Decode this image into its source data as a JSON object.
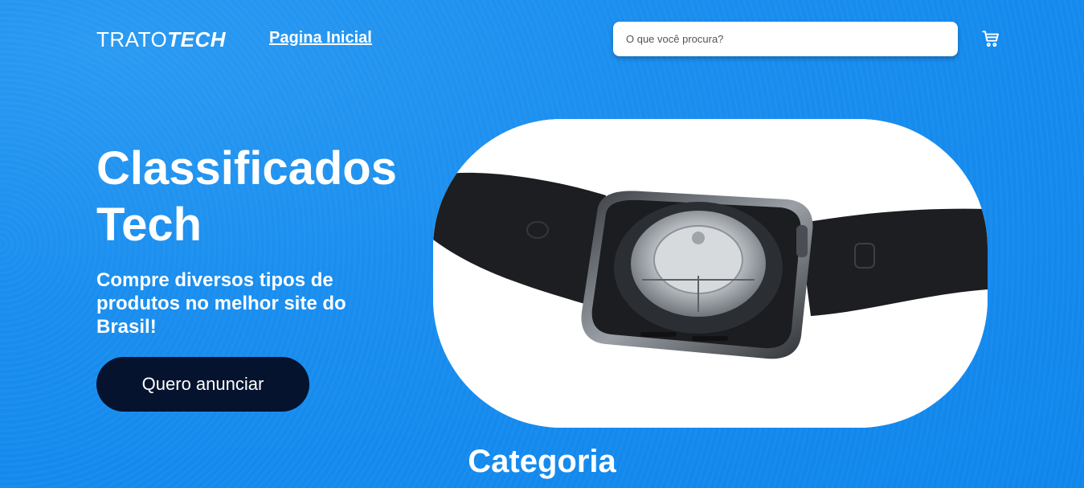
{
  "header": {
    "logo_part1": "TRATO",
    "logo_part2": "TECH",
    "nav_home": "Pagina Inicial",
    "search_placeholder": "O que você procura?",
    "cart_icon": "shopping-cart-icon"
  },
  "hero": {
    "title": "Classificados Tech",
    "subtitle": "Compre diversos tipos de produtos no melhor site do Brasil!",
    "cta_label": "Quero anunciar",
    "image_subject": "smartwatch-back-photo"
  },
  "sections": {
    "category_title": "Categoria"
  },
  "colors": {
    "background": "#1a8eef",
    "cta_background": "#05132e",
    "text": "#ffffff"
  }
}
